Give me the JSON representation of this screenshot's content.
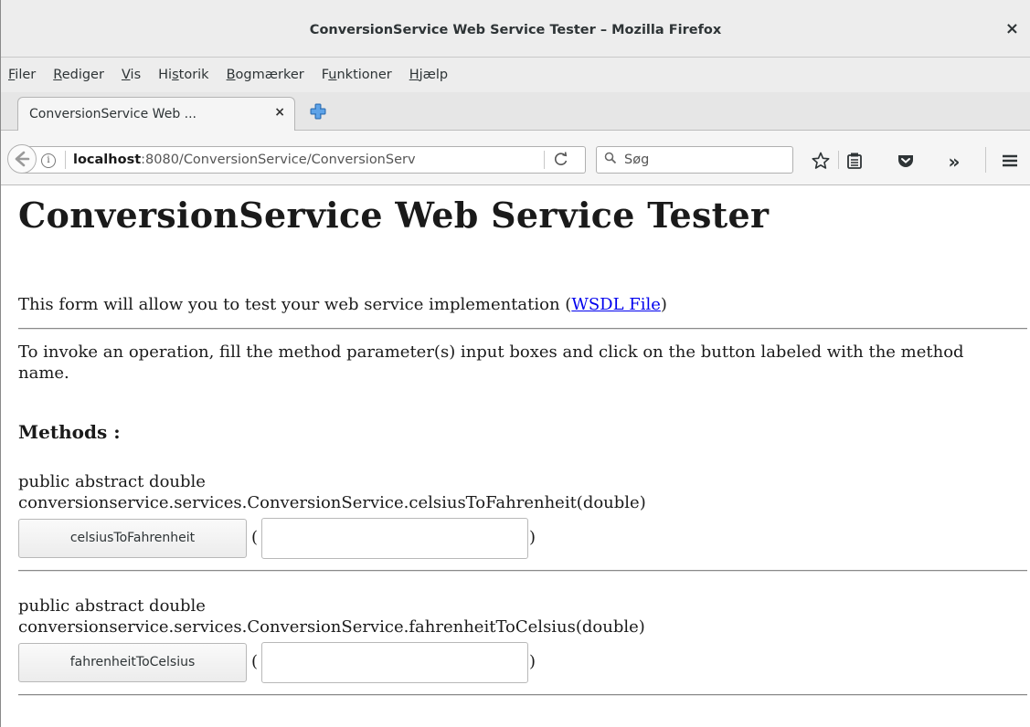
{
  "window": {
    "title": "ConversionService Web Service Tester – Mozilla Firefox",
    "close_glyph": "×"
  },
  "menu": [
    {
      "pre": "",
      "key": "F",
      "post": "iler"
    },
    {
      "pre": "",
      "key": "R",
      "post": "ediger"
    },
    {
      "pre": "",
      "key": "V",
      "post": "is"
    },
    {
      "pre": "Hi",
      "key": "s",
      "post": "torik"
    },
    {
      "pre": "",
      "key": "B",
      "post": "ogmærker"
    },
    {
      "pre": "F",
      "key": "u",
      "post": "nktioner"
    },
    {
      "pre": "",
      "key": "H",
      "post": "jælp"
    }
  ],
  "tab": {
    "label": "ConversionService Web ...",
    "close_glyph": "×"
  },
  "nav": {
    "url_host": "localhost",
    "url_rest": ":8080/ConversionService/ConversionServ",
    "reload_glyph": "C",
    "search_placeholder": "Søg",
    "overflow_glyph": "»",
    "hamburger_glyph": "≡"
  },
  "page": {
    "heading": "ConversionService Web Service Tester",
    "intro_text": "This form will allow you to test your web service implementation (",
    "wsdl_link": "WSDL File",
    "intro_close": ")",
    "instructions": "To invoke an operation, fill the method parameter(s) input boxes and click on the button labeled with the method name.",
    "methods_heading": "Methods :",
    "methods": [
      {
        "sig_line1": "public abstract double",
        "sig_line2": "conversionservice.services.ConversionService.celsiusToFahrenheit(double)",
        "button": "celsiusToFahrenheit",
        "open_paren": "(",
        "close_paren": ")",
        "value": ""
      },
      {
        "sig_line1": "public abstract double",
        "sig_line2": "conversionservice.services.ConversionService.fahrenheitToCelsius(double)",
        "button": "fahrenheitToCelsius",
        "open_paren": "(",
        "close_paren": ")",
        "value": ""
      }
    ]
  }
}
